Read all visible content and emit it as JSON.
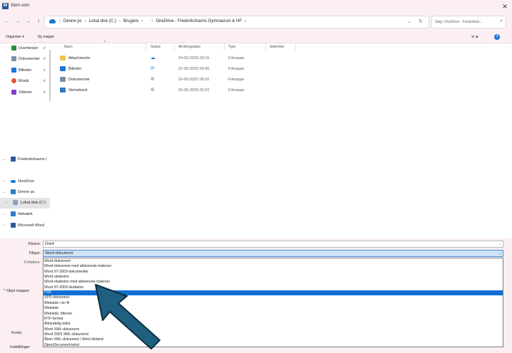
{
  "window": {
    "title": "Gem som",
    "close": "✕"
  },
  "nav": {
    "back": "←",
    "forward": "→",
    "dropdown": "⌄",
    "up": "↑",
    "breadcrumbs": [
      "Denne pc",
      "Lokal disk (C:)",
      "Brugere",
      "OneDrive - Frederikshavns Gymnasium & HF"
    ],
    "separator": "›",
    "search_placeholder": "Søg i OneDrive - Frederiksh...",
    "refresh": "↻"
  },
  "commands": {
    "organize": "Organiser ▾",
    "new_folder": "Ny mappe",
    "view": "≡ ▾",
    "help": "?"
  },
  "sidebar": {
    "quick": [
      {
        "label": "Overførsler",
        "color": "#2b8a3e"
      },
      {
        "label": "Dokumenter",
        "color": "#7a8ea8"
      },
      {
        "label": "Billeder",
        "color": "#1c77d4"
      },
      {
        "label": "Musik",
        "color": "#e0533a"
      },
      {
        "label": "Videoer",
        "color": "#8a3fc7"
      }
    ],
    "pin": "⊀",
    "tree": [
      {
        "label": "Frederikshavns I",
        "chev": "⌄"
      },
      {
        "label": "OneDrive",
        "chev": "›"
      },
      {
        "label": "Denne pc",
        "chev": "⌄"
      },
      {
        "label": "Lokal disk (C:)",
        "chev": "›"
      },
      {
        "label": "Netværk",
        "chev": "›"
      },
      {
        "label": "Microsoft Word",
        "chev": "›"
      }
    ]
  },
  "columns": {
    "name": "Navn",
    "status": "Status",
    "date": "Ændringsdato",
    "type": "Type",
    "size": "Størrelse",
    "sort": "^"
  },
  "files": [
    {
      "name": "Attachments",
      "status": "☁",
      "status_color": "#1c77d4",
      "date": "24-03-2025 09:15",
      "type": "Filmappe",
      "color": "#f2c14e"
    },
    {
      "name": "Billeder",
      "status": "⟳",
      "status_color": "#1c77d4",
      "date": "22-05-2025 09:45",
      "type": "Filmappe",
      "color": "#1c77d4"
    },
    {
      "name": "Dokumenter",
      "status": "⊘",
      "status_color": "#2b8a3e",
      "date": "20-05-2025 09:20",
      "type": "Filmappe",
      "color": "#7a8ea8"
    },
    {
      "name": "Skrivebord",
      "status": "⊘",
      "status_color": "#2b8a3e",
      "date": "20-05-2025 09:20",
      "type": "Filmappe",
      "color": "#2d7dc8"
    }
  ],
  "save": {
    "filename_label": "Filnavn:",
    "filename_value": "Dok4",
    "filetype_label": "Filtype:",
    "filetype_value": "Word-dokument",
    "authors_label": "Forfattere:",
    "hide_folders": "^ Skjul mapper",
    "dd_arrow": "⌄",
    "options": [
      "Word-dokument",
      "Word-dokument med aktiverede makroer",
      "Word 97-2003-dokumenter",
      "Word-skabelon",
      "Word-skabelon med aktiverede makroer",
      "Word 97-2003-skabelon",
      "PDF",
      "XPS-dokument",
      "Webside i én fil",
      "Webside",
      "Webside, filtreret",
      "RTF-format",
      "Almindelig tekst",
      "Word XML-dokument",
      "Word 2003 XML-dokument",
      "Åben XML-dokument i Strict-tilstand",
      "OpenDocument-tekst"
    ],
    "selected_index": 6
  },
  "backstage": {
    "account": "Konto",
    "settings": "Indstillinger"
  },
  "colors": {
    "accent": "#0f6fd2",
    "arrow": "#1f5f7f"
  }
}
